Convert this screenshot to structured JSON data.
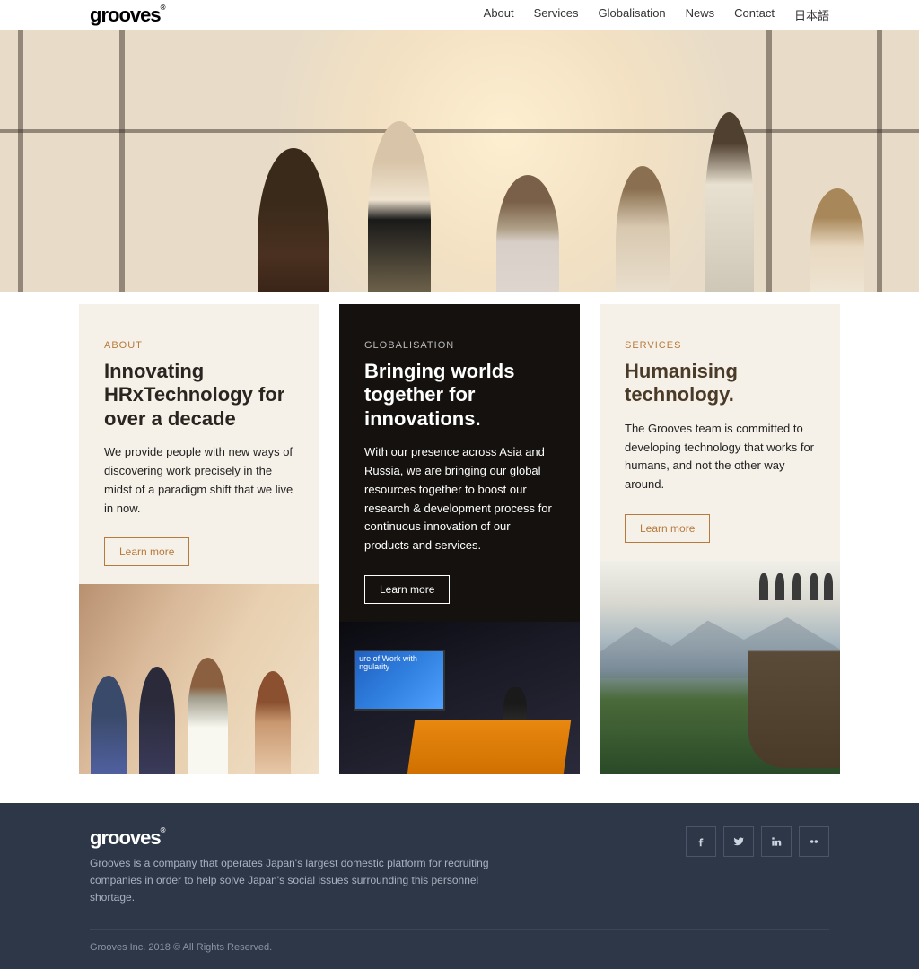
{
  "brand": "grooves",
  "nav": {
    "about": "About",
    "services": "Services",
    "globalisation": "Globalisation",
    "news": "News",
    "contact": "Contact",
    "japanese": "日本語"
  },
  "cards": {
    "about": {
      "tag": "ABOUT",
      "title": "Innovating HRxTechnology for over a decade",
      "body": "We provide people with new ways of discovering work precisely in the midst of a paradigm shift that we live in now.",
      "cta": "Learn more"
    },
    "globalisation": {
      "tag": "GLOBALISATION",
      "title": "Bringing worlds together for innovations.",
      "body": "With our presence across Asia and Russia, we are bringing our global resources together to boost our research & development process for continuous innovation of our products and services.",
      "cta": "Learn more",
      "screen_text": "ure of Work with ngularity"
    },
    "services": {
      "tag": "SERVICES",
      "title": "Humanising technology.",
      "body": "The Grooves team is committed to developing technology that works for humans, and not the other way around.",
      "cta": "Learn more"
    }
  },
  "footer": {
    "desc": "Grooves is a company that operates Japan's largest domestic platform for recruiting companies in order to help solve Japan's social issues surrounding this personnel shortage.",
    "copyright": "Grooves Inc. 2018 © All Rights Reserved."
  }
}
